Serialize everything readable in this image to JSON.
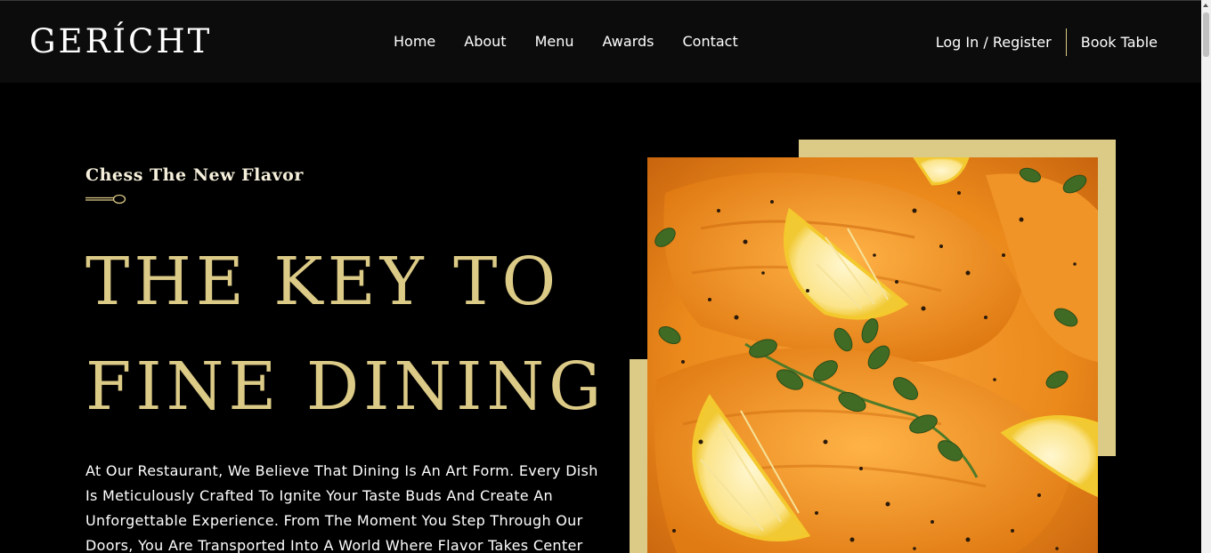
{
  "brand": {
    "logo_text": "GERÍCHT",
    "accent_color": "#dcca87",
    "background_color": "#000000"
  },
  "nav": {
    "items": [
      {
        "label": "Home"
      },
      {
        "label": "About"
      },
      {
        "label": "Menu"
      },
      {
        "label": "Awards"
      },
      {
        "label": "Contact"
      }
    ],
    "login_label": "Log In / Register",
    "book_label": "Book Table"
  },
  "hero": {
    "subtitle": "Chess The New Flavor",
    "headline_line1": "THE KEY TO",
    "headline_line2": "FINE DINING",
    "description": "At Our Restaurant, We Believe That Dining Is An Art Form. Every Dish Is Meticulously Crafted To Ignite Your Taste Buds And Create An Unforgettable Experience. From The Moment You Step Through Our Doors, You Are Transported Into A World Where Flavor Takes Center",
    "image_icon": "salmon-dish-image"
  }
}
